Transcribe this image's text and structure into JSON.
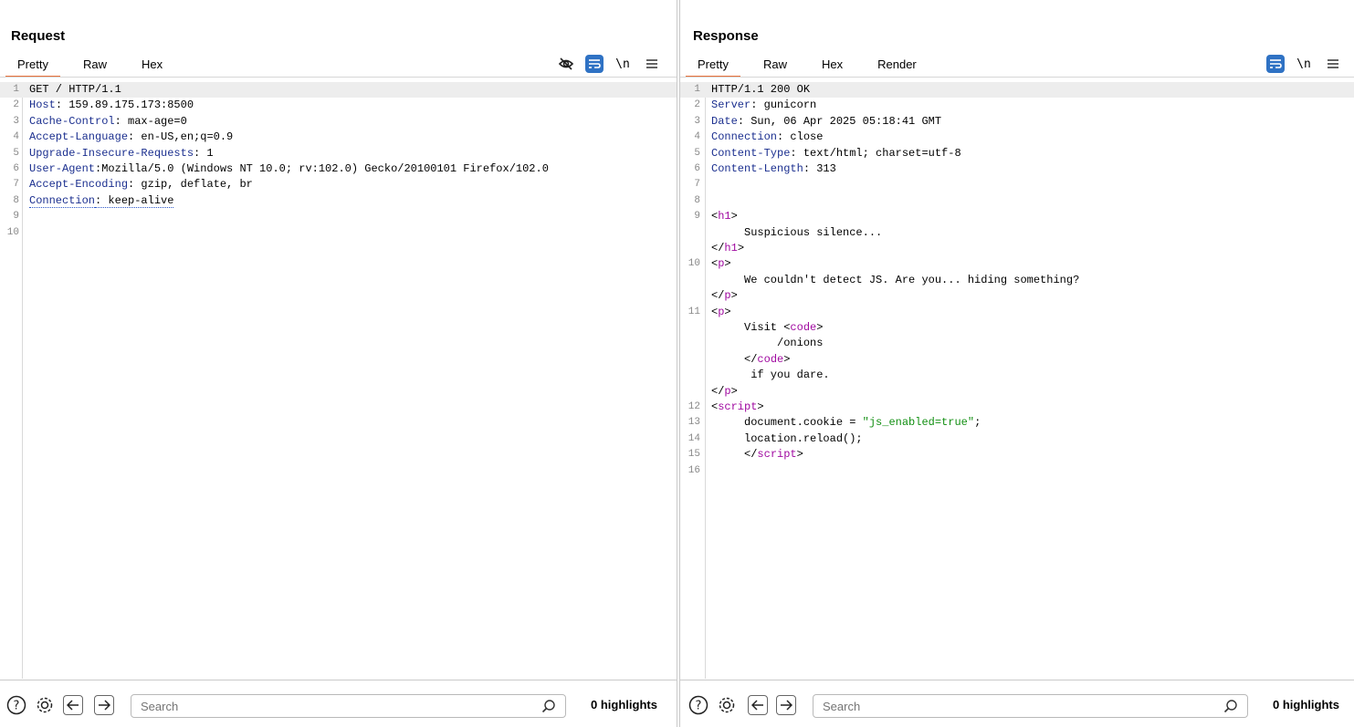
{
  "request": {
    "title": "Request",
    "tabs": [
      "Pretty",
      "Raw",
      "Hex"
    ],
    "active_tab": "Pretty",
    "tool_icons": [
      "eye-slash-icon",
      "wrap-icon",
      "newline-icon",
      "menu-icon"
    ],
    "newline_label": "\\n",
    "lines": [
      {
        "n": "1",
        "parts": [
          {
            "t": "GET / HTTP/1.1",
            "c": ""
          }
        ]
      },
      {
        "n": "2",
        "parts": [
          {
            "t": "Host",
            "c": "key"
          },
          {
            "t": ": 159.89.175.173:8500",
            "c": ""
          }
        ]
      },
      {
        "n": "3",
        "parts": [
          {
            "t": "Cache-Control",
            "c": "key"
          },
          {
            "t": ": max-age=0",
            "c": ""
          }
        ]
      },
      {
        "n": "4",
        "parts": [
          {
            "t": "Accept-Language",
            "c": "key"
          },
          {
            "t": ": en-US,en;q=0.9",
            "c": ""
          }
        ]
      },
      {
        "n": "5",
        "parts": [
          {
            "t": "Upgrade-Insecure-Requests",
            "c": "key"
          },
          {
            "t": ": 1",
            "c": ""
          }
        ]
      },
      {
        "n": "6",
        "parts": [
          {
            "t": "User-Agent",
            "c": "key"
          },
          {
            "t": ":Mozilla/5.0 (Windows NT 10.0; rv:102.0) Gecko/20100101 Firefox/102.0",
            "c": ""
          }
        ]
      },
      {
        "n": "7",
        "parts": [
          {
            "t": "Accept-Encoding",
            "c": "key"
          },
          {
            "t": ": gzip, deflate, br",
            "c": ""
          }
        ]
      },
      {
        "n": "8",
        "parts": [
          {
            "t": "Connection",
            "c": "key dotted"
          },
          {
            "t": ": keep-alive",
            "c": "dotted"
          }
        ]
      },
      {
        "n": "9",
        "parts": []
      },
      {
        "n": "10",
        "parts": []
      }
    ],
    "search_placeholder": "Search",
    "highlights": "0 highlights"
  },
  "response": {
    "title": "Response",
    "tabs": [
      "Pretty",
      "Raw",
      "Hex",
      "Render"
    ],
    "active_tab": "Pretty",
    "tool_icons": [
      "wrap-icon",
      "newline-icon",
      "menu-icon"
    ],
    "newline_label": "\\n",
    "lines": [
      {
        "n": "1",
        "parts": [
          {
            "t": "HTTP/1.1 200 OK",
            "c": ""
          }
        ]
      },
      {
        "n": "2",
        "parts": [
          {
            "t": "Server",
            "c": "key"
          },
          {
            "t": ": gunicorn",
            "c": ""
          }
        ]
      },
      {
        "n": "3",
        "parts": [
          {
            "t": "Date",
            "c": "key"
          },
          {
            "t": ": Sun, 06 Apr 2025 05:18:41 GMT",
            "c": ""
          }
        ]
      },
      {
        "n": "4",
        "parts": [
          {
            "t": "Connection",
            "c": "key"
          },
          {
            "t": ": close",
            "c": ""
          }
        ]
      },
      {
        "n": "5",
        "parts": [
          {
            "t": "Content-Type",
            "c": "key"
          },
          {
            "t": ": text/html; charset=utf-8",
            "c": ""
          }
        ]
      },
      {
        "n": "6",
        "parts": [
          {
            "t": "Content-Length",
            "c": "key"
          },
          {
            "t": ": 313",
            "c": ""
          }
        ]
      },
      {
        "n": "7",
        "parts": []
      },
      {
        "n": "8",
        "parts": []
      },
      {
        "n": "9",
        "parts": [
          {
            "t": "<",
            "c": ""
          },
          {
            "t": "h1",
            "c": "tag"
          },
          {
            "t": ">",
            "c": ""
          }
        ]
      },
      {
        "n": "",
        "parts": [
          {
            "t": "     Suspicious silence...",
            "c": ""
          }
        ]
      },
      {
        "n": "",
        "parts": [
          {
            "t": "</",
            "c": ""
          },
          {
            "t": "h1",
            "c": "tag"
          },
          {
            "t": ">",
            "c": ""
          }
        ]
      },
      {
        "n": "10",
        "parts": [
          {
            "t": "<",
            "c": ""
          },
          {
            "t": "p",
            "c": "tag"
          },
          {
            "t": ">",
            "c": ""
          }
        ]
      },
      {
        "n": "",
        "parts": [
          {
            "t": "     We couldn't detect JS. Are you... hiding something?",
            "c": ""
          }
        ]
      },
      {
        "n": "",
        "parts": [
          {
            "t": "</",
            "c": ""
          },
          {
            "t": "p",
            "c": "tag"
          },
          {
            "t": ">",
            "c": ""
          }
        ]
      },
      {
        "n": "11",
        "parts": [
          {
            "t": "<",
            "c": ""
          },
          {
            "t": "p",
            "c": "tag"
          },
          {
            "t": ">",
            "c": ""
          }
        ]
      },
      {
        "n": "",
        "parts": [
          {
            "t": "     Visit <",
            "c": ""
          },
          {
            "t": "code",
            "c": "tag"
          },
          {
            "t": ">",
            "c": ""
          }
        ]
      },
      {
        "n": "",
        "parts": [
          {
            "t": "          /onions",
            "c": ""
          }
        ]
      },
      {
        "n": "",
        "parts": [
          {
            "t": "     </",
            "c": ""
          },
          {
            "t": "code",
            "c": "tag"
          },
          {
            "t": ">",
            "c": ""
          }
        ]
      },
      {
        "n": "",
        "parts": [
          {
            "t": "      if you dare.",
            "c": ""
          }
        ]
      },
      {
        "n": "",
        "parts": [
          {
            "t": "</",
            "c": ""
          },
          {
            "t": "p",
            "c": "tag"
          },
          {
            "t": ">",
            "c": ""
          }
        ]
      },
      {
        "n": "12",
        "parts": [
          {
            "t": "<",
            "c": ""
          },
          {
            "t": "script",
            "c": "tag"
          },
          {
            "t": ">",
            "c": ""
          }
        ]
      },
      {
        "n": "13",
        "parts": [
          {
            "t": "     document.cookie = ",
            "c": ""
          },
          {
            "t": "\"js_enabled=true\"",
            "c": "str"
          },
          {
            "t": ";",
            "c": ""
          }
        ]
      },
      {
        "n": "14",
        "parts": [
          {
            "t": "     location.reload();",
            "c": ""
          }
        ]
      },
      {
        "n": "15",
        "parts": [
          {
            "t": "     </",
            "c": ""
          },
          {
            "t": "script",
            "c": "tag"
          },
          {
            "t": ">",
            "c": ""
          }
        ]
      },
      {
        "n": "16",
        "parts": []
      }
    ],
    "search_placeholder": "Search",
    "highlights": "0 highlights"
  },
  "view_toggle": [
    "split-vertical-icon",
    "split-horizontal-icon",
    "single-pane-icon"
  ],
  "colors": {
    "accent": "#e8703a",
    "blue": "#2f72c4",
    "key": "#1b2f8f",
    "tag": "#a00aa0",
    "string": "#128f12"
  }
}
